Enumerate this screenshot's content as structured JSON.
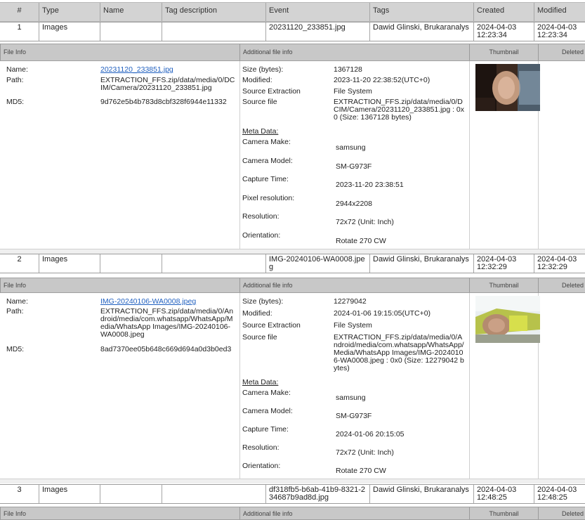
{
  "columns": [
    "#",
    "Type",
    "Name",
    "Tag description",
    "Event",
    "Tags",
    "Created",
    "Modified"
  ],
  "section_headers": {
    "file_info": "File Info",
    "additional": "Additional file info",
    "thumbnail": "Thumbnail",
    "deleted": "Deleted"
  },
  "labels": {
    "name": "Name:",
    "path": "Path:",
    "md5": "MD5:",
    "size": "Size (bytes):",
    "modified": "Modified:",
    "source_extraction": "Source Extraction",
    "source_file": "Source file",
    "meta_data": "Meta Data:",
    "camera_make": "Camera Make:",
    "camera_model": "Camera Model:",
    "capture_time": "Capture Time:",
    "pixel_resolution": "Pixel resolution:",
    "resolution": "Resolution:",
    "orientation": "Orientation:"
  },
  "rows": [
    {
      "num": "1",
      "type": "Images",
      "name": "",
      "tag_description": "",
      "event": "20231120_233851.jpg",
      "tags": "Dawid Glinski, Brukaranalys",
      "created": "2024-04-03 12:23:34",
      "modified": "2024-04-03 12:23:34",
      "detail": {
        "name": "20231120_233851.jpg",
        "path": "EXTRACTION_FFS.zip/data/media/0/DCIM/Camera/20231120_233851.jpg",
        "md5": "9d762e5b4b783d8cbf328f6944e11332",
        "size": "1367128",
        "modified": "2023-11-20 22:38:52(UTC+0)",
        "source_extraction": "File System",
        "source_file": "EXTRACTION_FFS.zip/data/media/0/DCIM/Camera/20231120_233851.jpg : 0x0 (Size: 1367128 bytes)",
        "camera_make": "samsung",
        "camera_model": "SM-G973F",
        "capture_time": "2023-11-20 23:38:51",
        "pixel_resolution": "2944x2208",
        "resolution": "72x72 (Unit: Inch)",
        "orientation": "Rotate 270 CW"
      }
    },
    {
      "num": "2",
      "type": "Images",
      "name": "",
      "tag_description": "",
      "event": "IMG-20240106-WA0008.jpeg",
      "tags": "Dawid Glinski, Brukaranalys",
      "created": "2024-04-03 12:32:29",
      "modified": "2024-04-03 12:32:29",
      "detail": {
        "name": "IMG-20240106-WA0008.jpeg",
        "path": "EXTRACTION_FFS.zip/data/media/0/Android/media/com.whatsapp/WhatsApp/Media/WhatsApp Images/IMG-20240106-WA0008.jpeg",
        "md5": "8ad7370ee05b648c669d694a0d3b0ed3",
        "size": "12279042",
        "modified": "2024-01-06 19:15:05(UTC+0)",
        "source_extraction": "File System",
        "source_file": "EXTRACTION_FFS.zip/data/media/0/Android/media/com.whatsapp/WhatsApp/Media/WhatsApp Images/IMG-20240106-WA0008.jpeg : 0x0 (Size: 12279042 bytes)",
        "camera_make": "samsung",
        "camera_model": "SM-G973F",
        "capture_time": "2024-01-06 20:15:05",
        "resolution": "72x72 (Unit: Inch)",
        "orientation": "Rotate 270 CW"
      }
    },
    {
      "num": "3",
      "type": "Images",
      "name": "",
      "tag_description": "",
      "event": "df318fb5-b6ab-41b9-8321-234687b9ad8d.jpg",
      "tags": "Dawid Glinski, Brukaranalys",
      "created": "2024-04-03 12:48:25",
      "modified": "2024-04-03 12:48:25"
    }
  ]
}
